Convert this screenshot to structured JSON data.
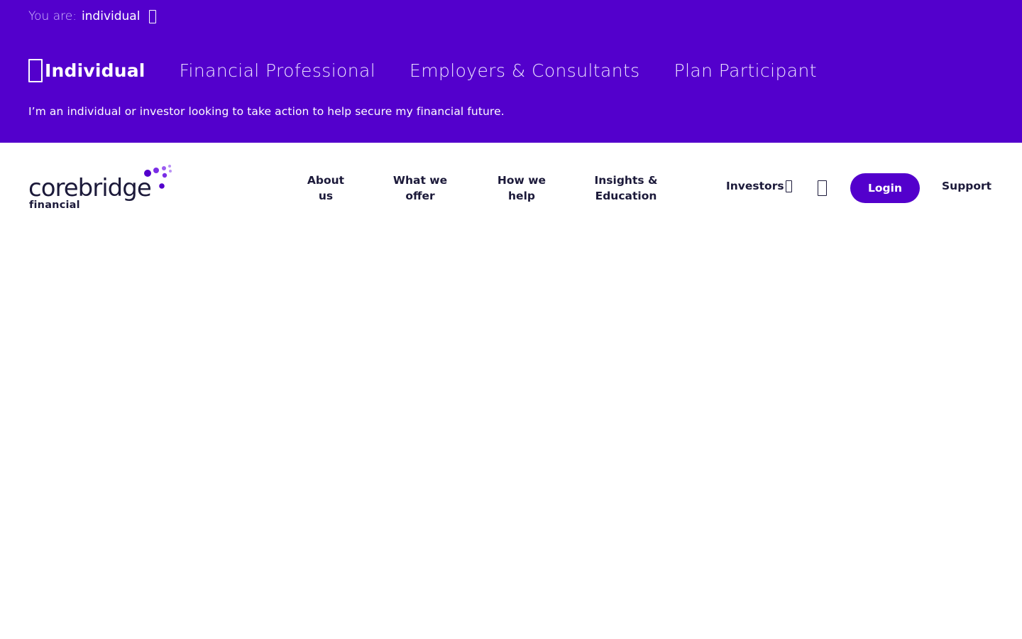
{
  "colors": {
    "brand_purple": "#5300cc",
    "navy_text": "#1c1a3a",
    "white": "#ffffff"
  },
  "audience_bar": {
    "you_are_label": "You are:",
    "you_are_value": "individual",
    "toggle_icon": "chevron-down-icon",
    "tabs": [
      {
        "label": "Individual",
        "active": true
      },
      {
        "label": "Financial Professional",
        "active": false
      },
      {
        "label": "Employers & Consultants",
        "active": false
      },
      {
        "label": "Plan Participant",
        "active": false
      }
    ],
    "description": "I’m an individual or investor looking to take action to help secure my financial future."
  },
  "logo": {
    "wordmark": "corebridge",
    "subtitle": "financial"
  },
  "nav": {
    "items": [
      {
        "line1": "About",
        "line2": "us"
      },
      {
        "line1": "What we",
        "line2": "offer"
      },
      {
        "line1": "How we",
        "line2": "help"
      },
      {
        "line1": "Insights &",
        "line2": "Education"
      }
    ],
    "investors": "Investors",
    "investors_icon": "external-link-icon",
    "search_icon": "search-icon",
    "login": "Login",
    "support": "Support"
  }
}
